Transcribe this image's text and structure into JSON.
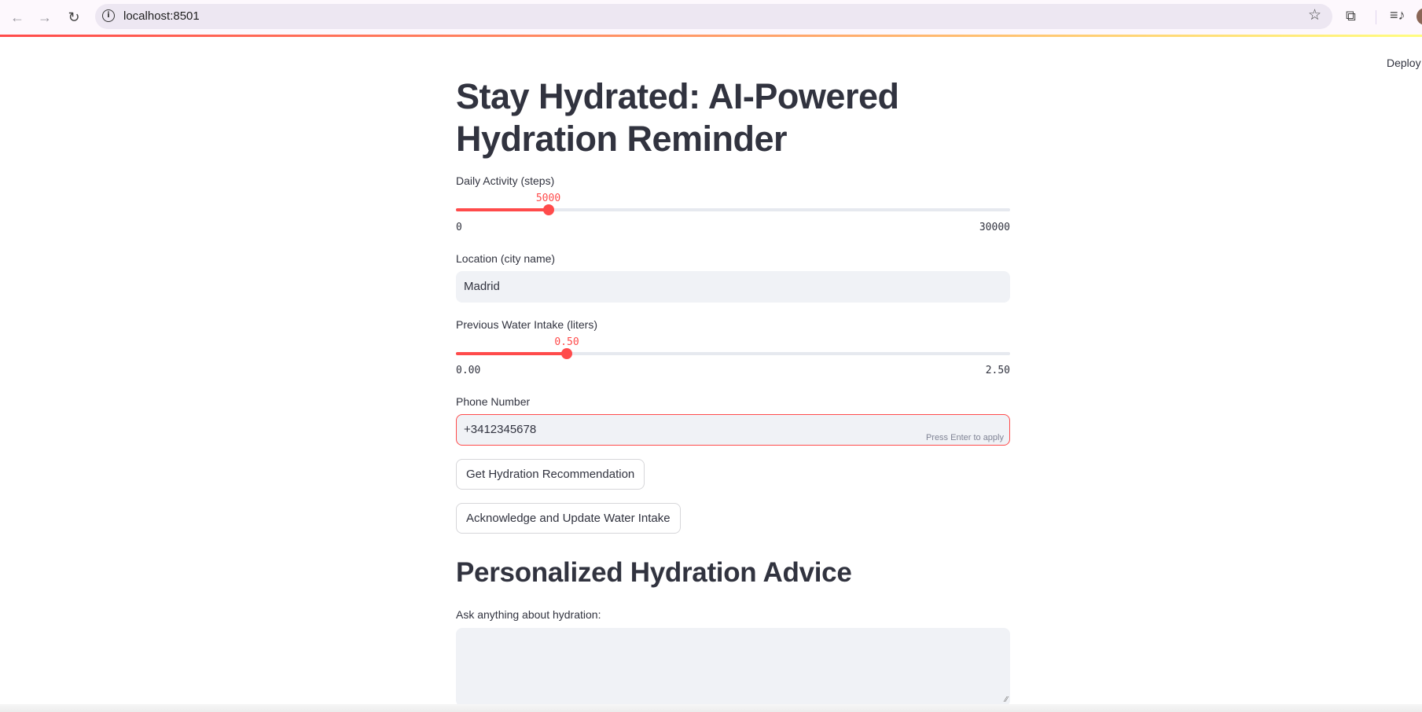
{
  "browser": {
    "url": "localhost:8501",
    "back_icon": "←",
    "forward_icon": "→",
    "reload_icon": "↻",
    "info_icon": "i",
    "star_icon": "☆",
    "extensions_icon": "⧉",
    "media_icon": "≡♪"
  },
  "app": {
    "deploy_label": "Deploy",
    "title": "Stay Hydrated: AI-Powered Hydration Reminder",
    "activity": {
      "label": "Daily Activity (steps)",
      "value": "5000",
      "min": "0",
      "max": "30000",
      "fraction": 0.1667
    },
    "location": {
      "label": "Location (city name)",
      "value": "Madrid"
    },
    "water": {
      "label": "Previous Water Intake (liters)",
      "value": "0.50",
      "min": "0.00",
      "max": "2.50",
      "fraction": 0.2
    },
    "phone": {
      "label": "Phone Number",
      "value": "+3412345678",
      "hint": "Press Enter to apply"
    },
    "buttons": {
      "recommend": "Get Hydration Recommendation",
      "acknowledge": "Acknowledge and Update Water Intake"
    },
    "advice": {
      "heading": "Personalized Hydration Advice",
      "label": "Ask anything about hydration:",
      "value": ""
    },
    "colors": {
      "accent": "#ff4b4b",
      "text": "#31333f",
      "input_bg": "#f0f2f6"
    }
  }
}
